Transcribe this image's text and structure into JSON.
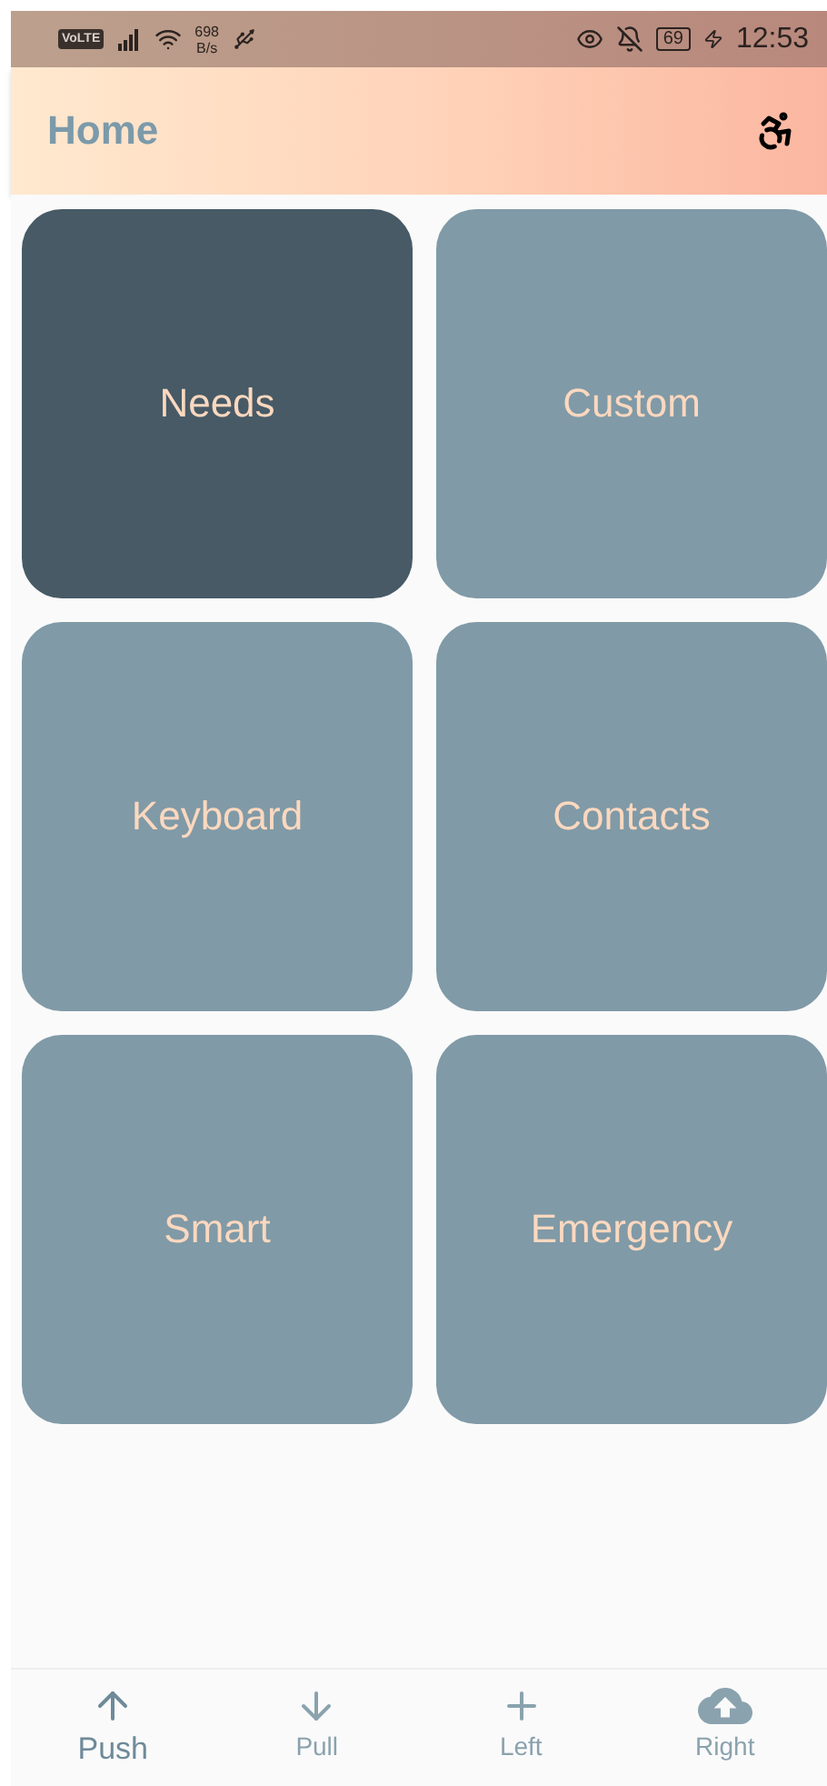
{
  "status_bar": {
    "network_badge": "VoLTE",
    "speed": "698",
    "speed_unit": "B/s",
    "battery": "69",
    "time": "12:53"
  },
  "app_bar": {
    "title": "Home"
  },
  "tiles": [
    {
      "label": "Needs",
      "selected": true
    },
    {
      "label": "Custom",
      "selected": false
    },
    {
      "label": "Keyboard",
      "selected": false
    },
    {
      "label": "Contacts",
      "selected": false
    },
    {
      "label": "Smart",
      "selected": false
    },
    {
      "label": "Emergency",
      "selected": false
    }
  ],
  "bottom_nav": [
    {
      "label": "Push",
      "kind": "up",
      "selected": true
    },
    {
      "label": "Pull",
      "kind": "down",
      "selected": false
    },
    {
      "label": "Left",
      "kind": "plus",
      "selected": false
    },
    {
      "label": "Right",
      "kind": "cloud",
      "selected": false
    }
  ]
}
